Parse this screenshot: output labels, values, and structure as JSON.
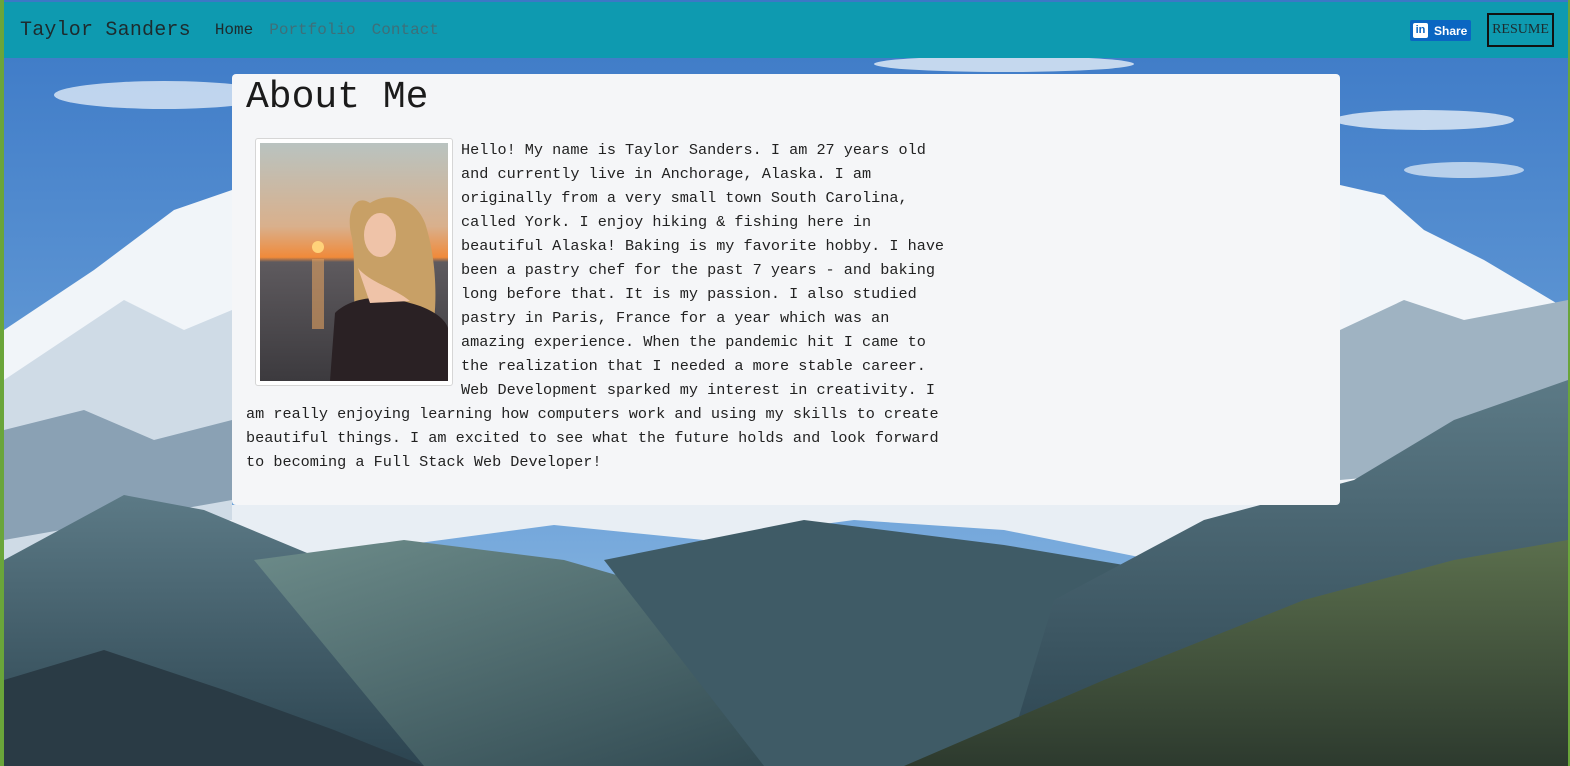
{
  "nav": {
    "brand": "Taylor Sanders",
    "links": [
      {
        "label": "Home",
        "state": "active"
      },
      {
        "label": "Portfolio",
        "state": "muted"
      },
      {
        "label": "Contact",
        "state": "muted"
      }
    ],
    "share_label": "Share",
    "linkedin_glyph": "in",
    "resume_label": "RESUME"
  },
  "about": {
    "title": "About Me",
    "bio": "Hello! My name is Taylor Sanders. I am 27 years old and currently live in Anchorage, Alaska. I am originally from a very small town South Carolina, called York. I enjoy hiking & fishing here in beautiful Alaska! Baking is my favorite hobby. I have been a pastry chef for the past 7 years - and baking long before that. It is my passion. I also studied pastry in Paris, France for a year which was an amazing experience. When the pandemic hit I came to the realization that I needed a more stable career. Web Development sparked my interest in creativity. I am really enjoying learning how computers work and using my skills to create beautiful things. I am excited to see what the future holds and look forward to becoming a Full Stack Web Developer!"
  },
  "colors": {
    "navbar": "#0e9ab0",
    "card": "#f5f6f8",
    "linkedin": "#0a66c2"
  }
}
